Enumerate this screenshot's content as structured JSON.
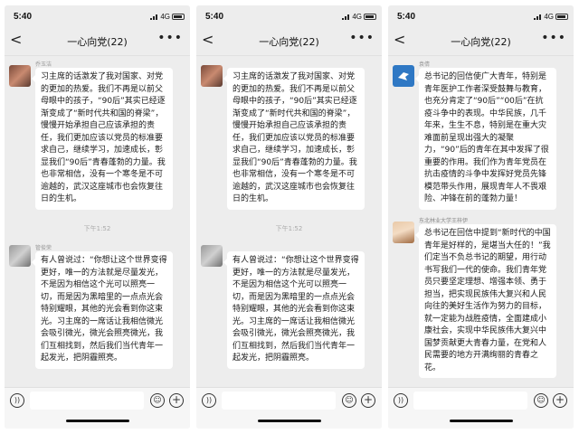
{
  "status": {
    "time": "5:40",
    "network": "4G"
  },
  "chat_title": "一心向党(22)",
  "nav": {
    "back_symbol": "<",
    "more_symbol": "•••"
  },
  "timestamp": "下午1:52",
  "panels": [
    {
      "msg1": {
        "sender": "乔玉洁",
        "text": "习主席的话激发了我对国家、对党的更加的热爱。我们不再是以前父母眼中的孩子，“90后”其实已经逐渐变成了“新时代共和国的脊梁”，慢慢开始承担自己应该承担的责任，我们更加应该以党员的标准要求自己，继续学习，加速成长，彰显我们“90后”青春蓬勃的力量。我也非常相信，没有一个寒冬是不可逾越的，武汉这座城市也会恢复往日的生机。"
      },
      "msg2": {
        "sender": "管俊荣",
        "text": "有人曾说过：“你想让这个世界变得更好，唯一的方法就是尽量发光，不是因为相信这个光可以照亮一切，而是因为黑暗里的一点点光会特别耀眼，其他的光会看到你这束光。习主席的一席话让我相信微光会吸引微光，微光会照亮微光，我们互相找到，然后我们当代青年一起发光，把阴霾照亮。"
      }
    },
    {
      "msg1": {
        "sender": "",
        "text": "习主席的话激发了我对国家、对党的更加的热爱。我们不再是以前父母眼中的孩子，“90后”其实已经逐渐变成了“新时代共和国的脊梁”，慢慢开始承担自己应该承担的责任，我们更加应该以党员的标准要求自己，继续学习，加速成长，彰显我们“90后”青春蓬勃的力量。我也非常相信，没有一个寒冬是不可逾越的，武汉这座城市也会恢复往日的生机。"
      },
      "msg2": {
        "sender": "",
        "text": "有人曾说过：“你想让这个世界变得更好，唯一的方法就是尽量发光，不是因为相信这个光可以照亮一切，而是因为黑暗里的一点点光会特别耀眼，其他的光会看到你这束光。习主席的一席话让我相信微光会吸引微光，微光会照亮微光，我们互相找到，然后我们当代青年一起发光，把阴霾照亮。"
      }
    },
    {
      "msg1": {
        "sender": "袁倩",
        "text": "总书记的回信使广大青年，特别是青年医护工作者深受鼓舞与教育，也充分肯定了“90后”“00后”在抗疫斗争中的表现。中华民族，几千年来，生生不息，特别是在重大灾难面前呈现出强大的凝聚力，“90”后的青年在其中发挥了很重要的作用。我们作为青年党员在抗击疫情的斗争中发挥好党员先锋模范带头作用，展现青年人不畏艰险、冲锋在前的蓬勃力量！"
      },
      "msg2": {
        "sender": "东北林业大学王梓伊",
        "text": "总书记在回信中提到“新时代的中国青年是好样的，是堪当大任的！”我们定当不负总书记的期望，用行动书写我们一代的使命。我们青年党员只要坚定理想、增强本领、勇于担当，把实现民族伟大复兴和人民向往的美好生活作为努力的目标，就一定能为战胜疫情，全面建成小康社会，实现中华民族伟大复兴中国梦贡献更大青春力量，在党和人民需要的地方开满绚丽的青春之花。"
      }
    }
  ]
}
